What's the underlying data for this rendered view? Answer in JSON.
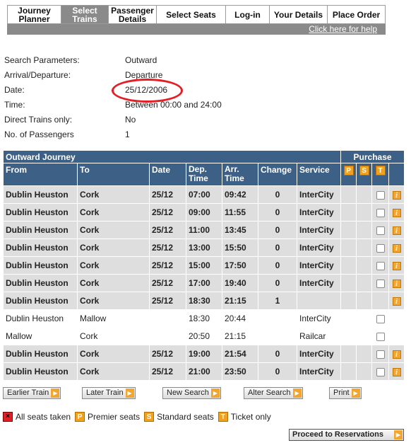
{
  "nav": {
    "steps": [
      {
        "line1": "Journey",
        "line2": "Planner"
      },
      {
        "line1": "Select",
        "line2": "Trains"
      },
      {
        "line1": "Passenger",
        "line2": "Details"
      },
      {
        "line1": "Select Seats",
        "line2": ""
      },
      {
        "line1": "Log-in",
        "line2": ""
      },
      {
        "line1": "Your Details",
        "line2": ""
      },
      {
        "line1": "Place Order",
        "line2": ""
      }
    ],
    "help_link": "Click here for help"
  },
  "params": [
    {
      "label": "Search Parameters:",
      "value": "Outward"
    },
    {
      "label": "Arrival/Departure:",
      "value": "Departure"
    },
    {
      "label": "Date:",
      "value": "25/12/2006"
    },
    {
      "label": "Time:",
      "value": "Between 00:00 and 24:00"
    },
    {
      "label": "Direct Trains only:",
      "value": "No"
    },
    {
      "label": "No. of Passengers",
      "value": "1"
    }
  ],
  "table": {
    "caption": "Outward Journey",
    "purchase": "Purchase",
    "headers": {
      "from": "From",
      "to": "To",
      "date": "Date",
      "dep": "Dep. Time",
      "arr": "Arr. Time",
      "change": "Change",
      "service": "Service"
    },
    "badges": {
      "p": "P",
      "s": "S",
      "t": "T"
    },
    "rows": [
      {
        "type": "dir",
        "from": "Dublin Heuston",
        "to": "Cork",
        "date": "25/12",
        "dep": "07:00",
        "arr": "09:42",
        "change": "0",
        "service": "InterCity"
      },
      {
        "type": "dir",
        "from": "Dublin Heuston",
        "to": "Cork",
        "date": "25/12",
        "dep": "09:00",
        "arr": "11:55",
        "change": "0",
        "service": "InterCity"
      },
      {
        "type": "dir",
        "from": "Dublin Heuston",
        "to": "Cork",
        "date": "25/12",
        "dep": "11:00",
        "arr": "13:45",
        "change": "0",
        "service": "InterCity"
      },
      {
        "type": "dir",
        "from": "Dublin Heuston",
        "to": "Cork",
        "date": "25/12",
        "dep": "13:00",
        "arr": "15:50",
        "change": "0",
        "service": "InterCity"
      },
      {
        "type": "dir",
        "from": "Dublin Heuston",
        "to": "Cork",
        "date": "25/12",
        "dep": "15:00",
        "arr": "17:50",
        "change": "0",
        "service": "InterCity"
      },
      {
        "type": "dir",
        "from": "Dublin Heuston",
        "to": "Cork",
        "date": "25/12",
        "dep": "17:00",
        "arr": "19:40",
        "change": "0",
        "service": "InterCity"
      },
      {
        "type": "dir",
        "from": "Dublin Heuston",
        "to": "Cork",
        "date": "25/12",
        "dep": "18:30",
        "arr": "21:15",
        "change": "1",
        "service": ""
      },
      {
        "type": "leg",
        "from": "Dublin Heuston",
        "to": "Mallow",
        "date": "",
        "dep": "18:30",
        "arr": "20:44",
        "change": "",
        "service": "InterCity"
      },
      {
        "type": "leg",
        "from": "Mallow",
        "to": "Cork",
        "date": "",
        "dep": "20:50",
        "arr": "21:15",
        "change": "",
        "service": "Railcar"
      },
      {
        "type": "dir",
        "from": "Dublin Heuston",
        "to": "Cork",
        "date": "25/12",
        "dep": "19:00",
        "arr": "21:54",
        "change": "0",
        "service": "InterCity"
      },
      {
        "type": "dir",
        "from": "Dublin Heuston",
        "to": "Cork",
        "date": "25/12",
        "dep": "21:00",
        "arr": "23:50",
        "change": "0",
        "service": "InterCity"
      }
    ]
  },
  "buttons": {
    "earlier": "Earlier Train",
    "later": "Later Train",
    "new_search": "New Search",
    "alter_search": "Alter Search",
    "print": "Print",
    "proceed": "Proceed to Reservations"
  },
  "legend": {
    "taken": "All seats taken",
    "premier": "Premier seats",
    "standard": "Standard seats",
    "ticket": "Ticket only"
  },
  "colors": {
    "header_blue": "#3d6087",
    "row_grey": "#dedede",
    "nav_active": "#8a8a8a",
    "accent_orange": "#f0a21f",
    "highlight_red": "#e31e25"
  }
}
